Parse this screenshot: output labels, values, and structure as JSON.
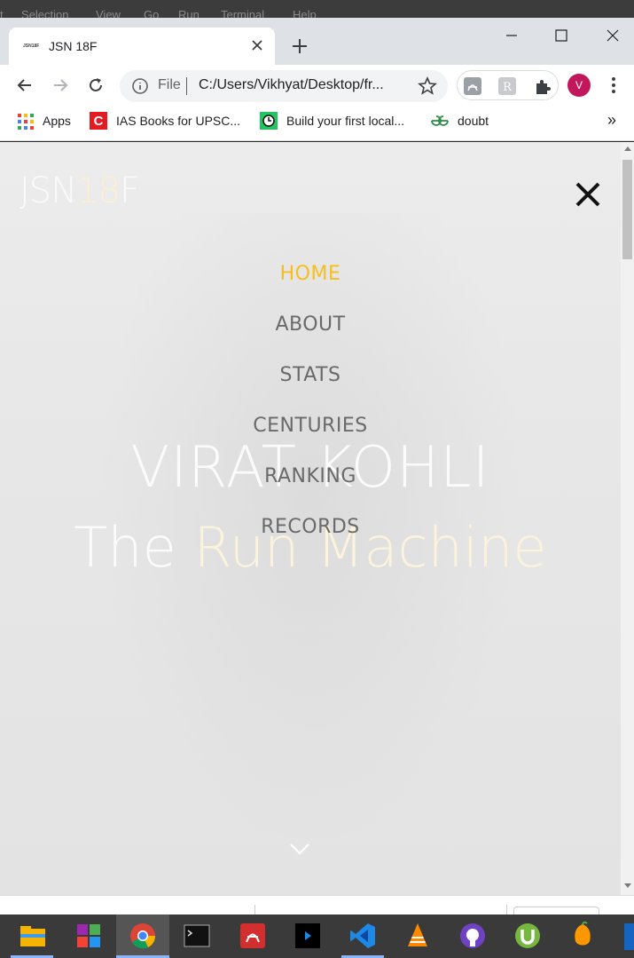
{
  "background_menu": [
    "t",
    "Selection",
    "View",
    "Go",
    "Run",
    "Terminal",
    "Help"
  ],
  "tab": {
    "favicon_text": "JSN18F",
    "title": "JSN 18F",
    "close_icon": "close-icon"
  },
  "toolbar": {
    "file_label": "File",
    "url": "C:/Users/Vikhyat/Desktop/fr...",
    "avatar_letter": "V"
  },
  "bookmarks": [
    {
      "label": "Apps",
      "icon": "apps-grid-icon"
    },
    {
      "label": "IAS Books for UPSC...",
      "icon": "c-logo-icon"
    },
    {
      "label": "Build your first local...",
      "icon": "clock-icon"
    },
    {
      "label": "doubt",
      "icon": "gfg-icon"
    }
  ],
  "bookmarks_overflow": "»",
  "page": {
    "logo_a": "JSN",
    "logo_b": "18",
    "logo_c": "F",
    "nav": [
      "HOME",
      "ABOUT",
      "STATS",
      "CENTURIES",
      "RANKING",
      "RECORDS"
    ],
    "hero_name": "VIRAT KOHLI",
    "hero_tag_a": "The ",
    "hero_tag_b": "Run Machine",
    "accent_color": "#f6be1f"
  },
  "taskbar_apps": [
    "file-explorer-icon",
    "winrar-icon",
    "chrome-icon",
    "terminal-icon",
    "acrobat-icon",
    "media-player-icon",
    "vscode-icon",
    "vlc-icon",
    "github-icon",
    "utorrent-icon",
    "fl-studio-icon"
  ]
}
